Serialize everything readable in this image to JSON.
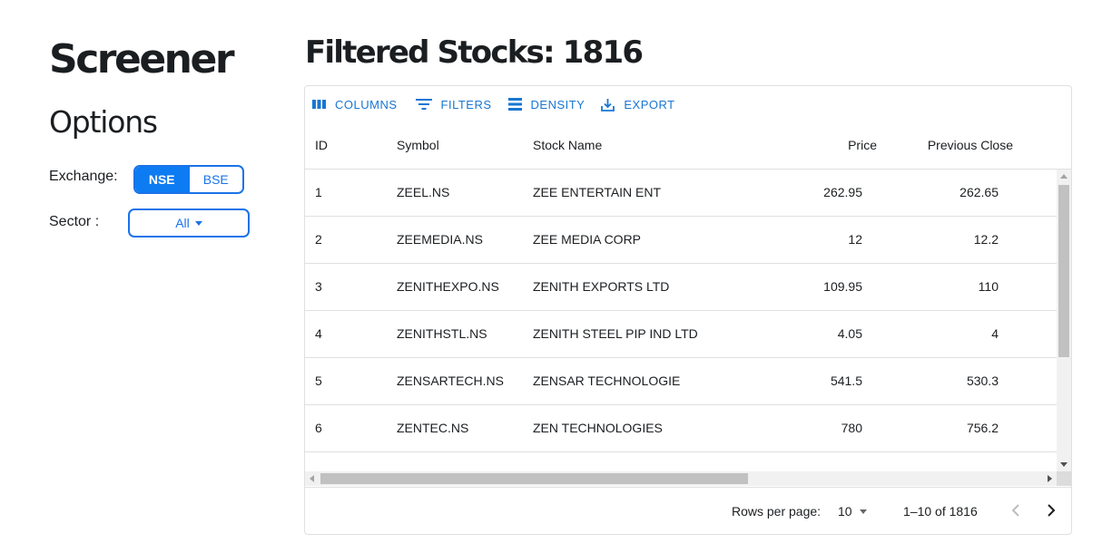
{
  "sidebar": {
    "app_title": "Screener",
    "options_title": "Options",
    "exchange_label": "Exchange:",
    "exchange_options": [
      "NSE",
      "BSE"
    ],
    "exchange_selected": "NSE",
    "sector_label": "Sector :",
    "sector_value": "All"
  },
  "main": {
    "title": "Filtered Stocks: 1816"
  },
  "toolbar": {
    "columns_label": "COLUMNS",
    "filters_label": "FILTERS",
    "density_label": "DENSITY",
    "export_label": "EXPORT"
  },
  "table": {
    "headers": [
      "ID",
      "Symbol",
      "Stock Name",
      "Price",
      "Previous Close"
    ],
    "rows": [
      [
        "1",
        "ZEEL.NS",
        "ZEE ENTERTAIN ENT",
        "262.95",
        "262.65"
      ],
      [
        "2",
        "ZEEMEDIA.NS",
        "ZEE MEDIA CORP",
        "12",
        "12.2"
      ],
      [
        "3",
        "ZENITHEXPO.NS",
        "ZENITH EXPORTS LTD",
        "109.95",
        "110"
      ],
      [
        "4",
        "ZENITHSTL.NS",
        "ZENITH STEEL PIP IND LTD",
        "4.05",
        "4"
      ],
      [
        "5",
        "ZENSARTECH.NS",
        "ZENSAR TECHNOLOGIE",
        "541.5",
        "530.3"
      ],
      [
        "6",
        "ZENTEC.NS",
        "ZEN TECHNOLOGIES",
        "780",
        "756.2"
      ]
    ]
  },
  "pagination": {
    "rows_per_page_label": "Rows per page:",
    "rows_per_page_value": "10",
    "range_text": "1–10 of 1816"
  },
  "colors": {
    "accent": "#1976d2",
    "toggle_active": "#0d7cf2"
  }
}
